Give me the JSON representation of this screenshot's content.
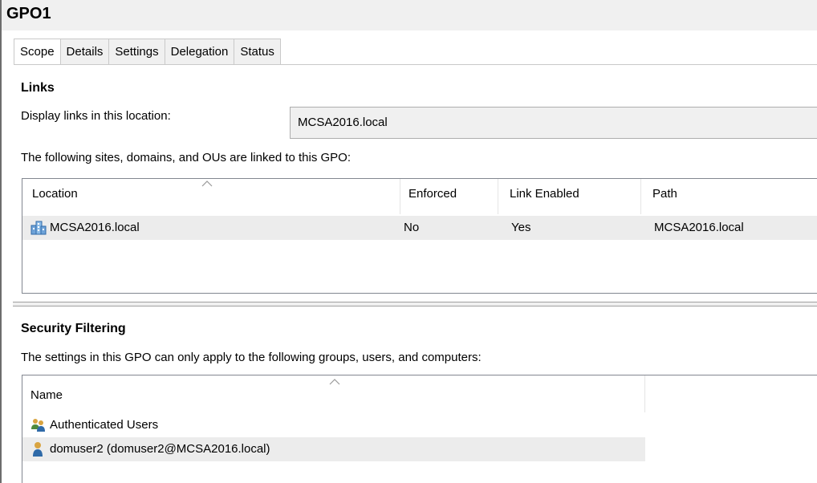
{
  "window": {
    "title": "GPO1"
  },
  "tabs": [
    {
      "label": "Scope"
    },
    {
      "label": "Details"
    },
    {
      "label": "Settings"
    },
    {
      "label": "Delegation"
    },
    {
      "label": "Status"
    }
  ],
  "links": {
    "heading": "Links",
    "display_label": "Display links in this location:",
    "location_value": "MCSA2016.local",
    "linked_label": "The following sites, domains, and OUs are linked to this GPO:",
    "columns": [
      "Location",
      "Enforced",
      "Link Enabled",
      "Path"
    ],
    "rows": [
      {
        "icon": "domain-icon",
        "location": "MCSA2016.local",
        "enforced": "No",
        "link_enabled": "Yes",
        "path": "MCSA2016.local"
      }
    ]
  },
  "security_filtering": {
    "heading": "Security Filtering",
    "description": "The settings in this GPO can only apply to the following groups, users, and computers:",
    "columns": [
      "Name"
    ],
    "rows": [
      {
        "icon": "user-group-icon",
        "name": "Authenticated Users"
      },
      {
        "icon": "user-icon",
        "name": "domuser2 (domuser2@MCSA2016.local)"
      }
    ]
  }
}
